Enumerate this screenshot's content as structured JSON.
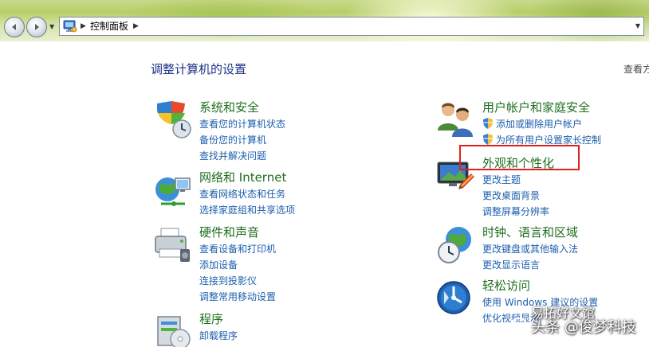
{
  "window": {
    "address_path": "控制面板",
    "separator": "▶",
    "dropdown_glyph": "▼"
  },
  "main": {
    "title": "调整计算机的设置",
    "view_by": "查看方"
  },
  "categories": [
    {
      "title": "系统和安全",
      "icon": "shield-computer-icon",
      "links": [
        "查看您的计算机状态",
        "备份您的计算机",
        "查找并解决问题"
      ]
    },
    {
      "title": "网络和 Internet",
      "icon": "network-globe-icon",
      "links": [
        "查看网络状态和任务",
        "选择家庭组和共享选项"
      ]
    },
    {
      "title": "硬件和声音",
      "icon": "printer-icon",
      "links": [
        "查看设备和打印机",
        "添加设备",
        "连接到投影仪",
        "调整常用移动设置"
      ]
    },
    {
      "title": "程序",
      "icon": "programs-icon",
      "links": [
        "卸载程序"
      ]
    },
    {
      "title": "用户帐户和家庭安全",
      "icon": "users-icon",
      "links": [
        "添加或删除用户帐户",
        "为所有用户设置家长控制"
      ]
    },
    {
      "title": "外观和个性化",
      "icon": "monitor-palette-icon",
      "links": [
        "更改主题",
        "更改桌面背景",
        "调整屏幕分辨率"
      ]
    },
    {
      "title": "时钟、语言和区域",
      "icon": "clock-globe-icon",
      "links": [
        "更改键盘或其他输入法",
        "更改显示语言"
      ]
    },
    {
      "title": "轻松访问",
      "icon": "ease-of-access-icon",
      "links": [
        "使用 Windows 建议的设置",
        "优化视频显示"
      ]
    }
  ],
  "watermark": {
    "text": "头条 @俊梦科技",
    "overlay_text": "易拓好文馆"
  },
  "colors": {
    "category_title": "#1e6e1e",
    "link": "#1d5fad",
    "page_title": "#1e3287",
    "highlight": "#e02020"
  }
}
